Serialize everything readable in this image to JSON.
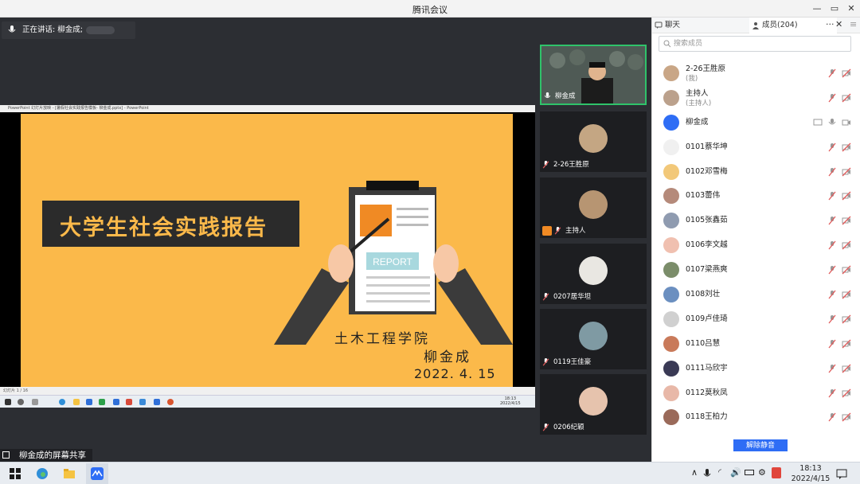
{
  "window": {
    "title": "腾讯会议"
  },
  "meeting": {
    "speaking_label": "正在讲话: 柳金成;",
    "share_label": "柳金成的屏幕共享",
    "ppt_titlebar": "PowerPoint 幻灯片放映 - [暑假社会实践报告模板- 柳金成.pptx] - PowerPoint",
    "ppt_statusbar": "幻灯片 1 / 16",
    "slide": {
      "title": "大学生社会实践报告",
      "report_tag": "REPORT",
      "school": "土木工程学院",
      "author": "柳金成",
      "date": "2022. 4. 15"
    },
    "inner_clock": {
      "time": "18:13",
      "date": "2022/4/15"
    }
  },
  "tiles": [
    {
      "name": "柳金成"
    },
    {
      "name": "2-26王胜原"
    },
    {
      "name": "主持人"
    },
    {
      "name": "0207居华坦"
    },
    {
      "name": "0119王佳豪"
    },
    {
      "name": "0206纪颖"
    }
  ],
  "panel": {
    "tab_chat": "聊天",
    "tab_members": "成员(204)",
    "more": "···",
    "close": "✕",
    "menu": "≡",
    "search_placeholder": "搜索成员",
    "members": [
      {
        "name": "2-26王胜原",
        "sub": "(我)"
      },
      {
        "name": "主持人",
        "sub": "(主持人)"
      },
      {
        "name": "柳金成",
        "sub": ""
      },
      {
        "name": "0101蔡华坤",
        "sub": ""
      },
      {
        "name": "0102邓雪梅",
        "sub": ""
      },
      {
        "name": "0103蕾伟",
        "sub": ""
      },
      {
        "name": "0105张鑫茹",
        "sub": ""
      },
      {
        "name": "0106李文越",
        "sub": ""
      },
      {
        "name": "0107梁燕爽",
        "sub": ""
      },
      {
        "name": "0108刘壮",
        "sub": ""
      },
      {
        "name": "0109卢佳琦",
        "sub": ""
      },
      {
        "name": "0110吕慧",
        "sub": ""
      },
      {
        "name": "0111马欣宇",
        "sub": ""
      },
      {
        "name": "0112莫秋凤",
        "sub": ""
      },
      {
        "name": "0118王柏力",
        "sub": ""
      }
    ],
    "unmute_all": "解除静音"
  },
  "taskbar": {
    "time": "18:13",
    "date": "2022/4/15"
  },
  "colors": {
    "accent": "#2e6df5",
    "slide_bg": "#fbb94a",
    "active_border": "#2fc36a",
    "muted": "#e05a5a"
  }
}
